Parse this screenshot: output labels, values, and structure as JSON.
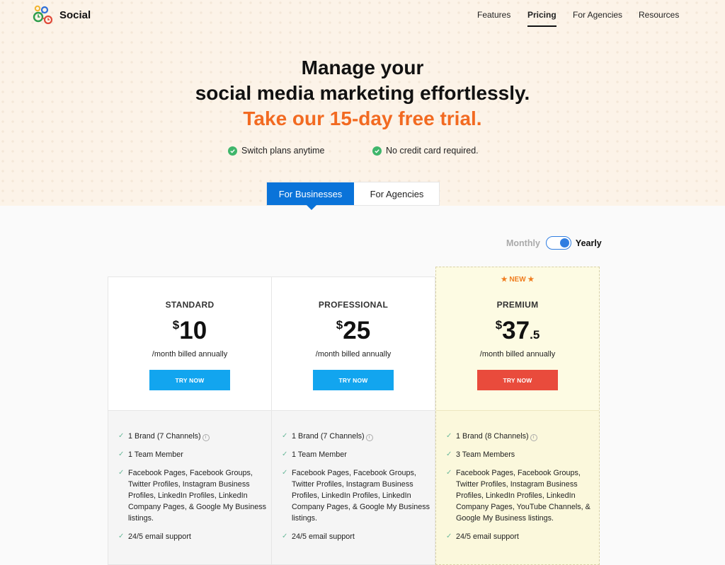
{
  "brand": {
    "name": "Social",
    "logo_icon": "social-logo-icon"
  },
  "nav": {
    "items": [
      {
        "label": "Features",
        "active": false
      },
      {
        "label": "Pricing",
        "active": true
      },
      {
        "label": "For Agencies",
        "active": false
      },
      {
        "label": "Resources",
        "active": false
      }
    ]
  },
  "hero": {
    "line1": "Manage your",
    "line2": "social media marketing effortlessly.",
    "line3": "Take our 15-day free trial.",
    "accent_color": "#f26a21",
    "perks": [
      {
        "icon": "check-circle-icon",
        "label": "Switch plans anytime"
      },
      {
        "icon": "check-circle-icon",
        "label": "No credit card required."
      }
    ]
  },
  "audience_tabs": {
    "tabs": [
      {
        "label": "For Businesses",
        "active": true
      },
      {
        "label": "For Agencies",
        "active": false
      }
    ],
    "active_color": "#0a73d9"
  },
  "billing": {
    "monthly_label": "Monthly",
    "yearly_label": "Yearly",
    "selected": "Yearly"
  },
  "plans": [
    {
      "badge": "",
      "name": "STANDARD",
      "currency": "$",
      "amount": "10",
      "decimal": "",
      "period": "/month billed annually",
      "button_label": "TRY NOW",
      "button_color": "#12a5ef",
      "features": [
        {
          "text": "1 Brand (7 Channels)",
          "info": true
        },
        {
          "text": "1 Team Member",
          "info": false
        },
        {
          "text": "Facebook Pages, Facebook Groups, Twitter Profiles, Instagram Business Profiles, LinkedIn Profiles, LinkedIn Company Pages, & Google My Business listings.",
          "info": false
        },
        {
          "text": "24/5 email support",
          "info": false
        }
      ]
    },
    {
      "badge": "",
      "name": "PROFESSIONAL",
      "currency": "$",
      "amount": "25",
      "decimal": "",
      "period": "/month billed annually",
      "button_label": "TRY NOW",
      "button_color": "#12a5ef",
      "features": [
        {
          "text": "1 Brand (7 Channels)",
          "info": true
        },
        {
          "text": "1 Team Member",
          "info": false
        },
        {
          "text": "Facebook Pages, Facebook Groups, Twitter Profiles, Instagram Business Profiles, LinkedIn Profiles, LinkedIn Company Pages, & Google My Business listings.",
          "info": false
        },
        {
          "text": "24/5 email support",
          "info": false
        }
      ]
    },
    {
      "badge": "★ NEW ★",
      "name": "PREMIUM",
      "currency": "$",
      "amount": "37",
      "decimal": ".5",
      "period": "/month billed annually",
      "button_label": "TRY NOW",
      "button_color": "#e94b3c",
      "features": [
        {
          "text": "1 Brand (8 Channels)",
          "info": true
        },
        {
          "text": "3 Team Members",
          "info": false
        },
        {
          "text": "Facebook Pages, Facebook Groups, Twitter Profiles, Instagram Business Profiles, LinkedIn Profiles, LinkedIn Company Pages, YouTube Channels, & Google My Business listings.",
          "info": false
        },
        {
          "text": "24/5 email support",
          "info": false
        }
      ]
    }
  ]
}
